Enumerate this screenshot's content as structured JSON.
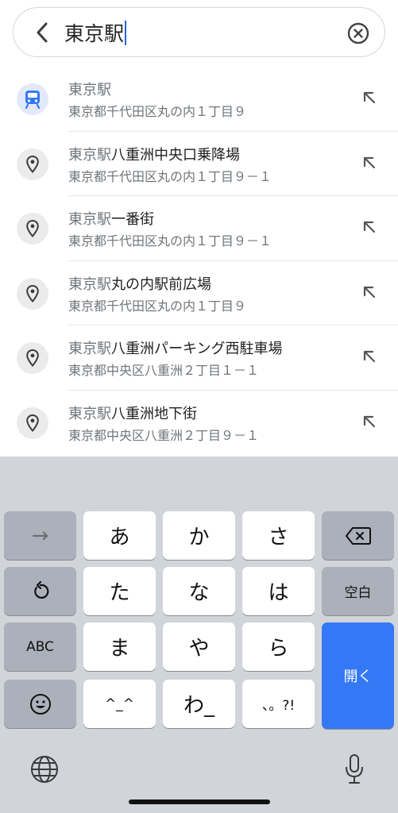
{
  "search": {
    "query": "東京駅"
  },
  "suggestions": [
    {
      "type": "transit",
      "icon": "train-icon",
      "match": "東京駅",
      "rest": "",
      "subtitle": "東京都千代田区丸の内１丁目９"
    },
    {
      "type": "place",
      "icon": "location-pin-icon",
      "match": "東京駅",
      "rest": "八重洲中央口乗降場",
      "subtitle": "東京都千代田区丸の内１丁目９－１"
    },
    {
      "type": "place",
      "icon": "location-pin-icon",
      "match": "東京駅",
      "rest": "一番街",
      "subtitle": "東京都千代田区丸の内１丁目９－１"
    },
    {
      "type": "place",
      "icon": "location-pin-icon",
      "match": "東京駅",
      "rest": "丸の内駅前広場",
      "subtitle": "東京都千代田区丸の内１丁目９"
    },
    {
      "type": "place",
      "icon": "location-pin-icon",
      "match": "東京駅",
      "rest": "八重洲パーキング西駐車場",
      "subtitle": "東京都中央区八重洲２丁目１－１"
    },
    {
      "type": "place",
      "icon": "location-pin-icon",
      "match": "東京駅",
      "rest": "八重洲地下街",
      "subtitle": "東京都中央区八重洲２丁目９－１"
    }
  ],
  "keyboard": {
    "arrow": "→",
    "keys": [
      "あ",
      "か",
      "さ",
      "た",
      "な",
      "は",
      "ま",
      "や",
      "ら",
      "^_^",
      "わ_",
      "、。?!"
    ],
    "space": "空白",
    "abc": "ABC",
    "enter": "開く"
  },
  "colors": {
    "accent": "#3478f6",
    "caret": "#2e62d9",
    "keyboard_bg": "#d1d4d9",
    "func_key": "#abb0ba"
  }
}
